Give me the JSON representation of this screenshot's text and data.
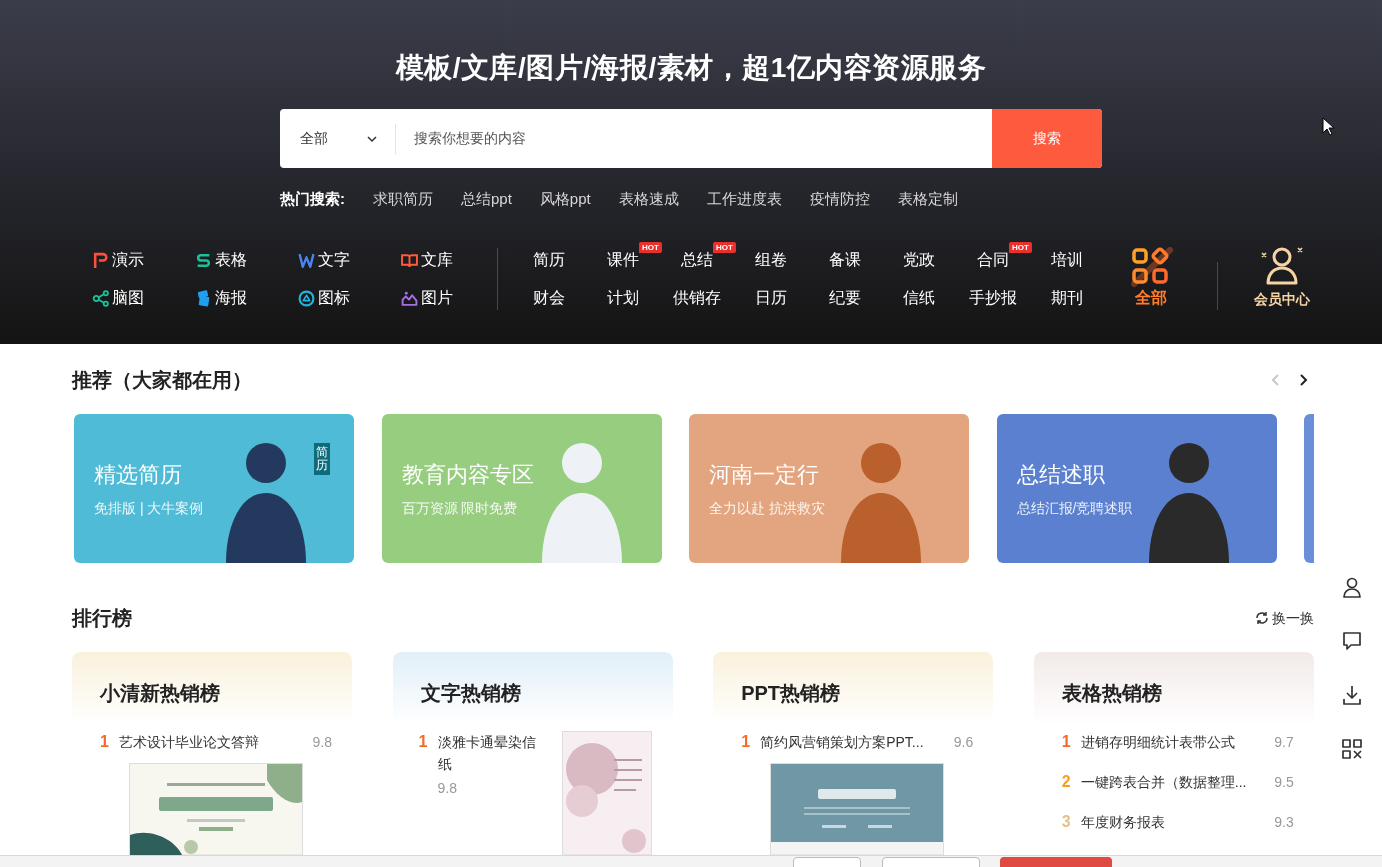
{
  "hero": {
    "title": "模板/文库/图片/海报/素材，超1亿内容资源服务",
    "search": {
      "scope": "全部",
      "placeholder": "搜索你想要的内容",
      "button": "搜索"
    },
    "hot_searches": {
      "label": "热门搜索:",
      "items": [
        "求职简历",
        "总结ppt",
        "风格ppt",
        "表格速成",
        "工作进度表",
        "疫情防控",
        "表格定制"
      ]
    }
  },
  "categories": {
    "tools": [
      {
        "kind": "slides",
        "label": "演示"
      },
      {
        "kind": "sheet",
        "label": "表格"
      },
      {
        "kind": "doc",
        "label": "文字"
      },
      {
        "kind": "library",
        "label": "文库"
      },
      {
        "kind": "mindmap",
        "label": "脑图"
      },
      {
        "kind": "poster",
        "label": "海报"
      },
      {
        "kind": "icon",
        "label": "图标"
      },
      {
        "kind": "image",
        "label": "图片"
      }
    ],
    "topics": [
      {
        "label": "简历"
      },
      {
        "label": "课件",
        "badge": "HOT"
      },
      {
        "label": "总结",
        "badge": "HOT"
      },
      {
        "label": "组卷"
      },
      {
        "label": "备课"
      },
      {
        "label": "党政"
      },
      {
        "label": "合同",
        "badge": "HOT"
      },
      {
        "label": "培训"
      },
      {
        "label": "财会"
      },
      {
        "label": "计划"
      },
      {
        "label": "供销存"
      },
      {
        "label": "日历"
      },
      {
        "label": "纪要"
      },
      {
        "label": "信纸"
      },
      {
        "label": "手抄报"
      },
      {
        "label": "期刊"
      }
    ],
    "all": {
      "label": "全部"
    },
    "member": {
      "label": "会员中心"
    }
  },
  "recommend": {
    "title": "推荐（大家都在用）",
    "prev": {
      "disabled": true
    },
    "next": {
      "disabled": false
    },
    "cards": [
      {
        "title": "精选简历",
        "subtitle": "免排版 | 大牛案例",
        "badge": "简历",
        "color": "#4fbbd6"
      },
      {
        "title": "教育内容专区",
        "subtitle": "百万资源 限时免费",
        "color": "#97cd7f"
      },
      {
        "title": "河南一定行",
        "subtitle": "全力以赴 抗洪救灾",
        "color": "#e3a57f"
      },
      {
        "title": "总结述职",
        "subtitle": "总结汇报/竞聘述职",
        "color": "#5b80cf"
      },
      {
        "color": "#6a8fd8"
      }
    ]
  },
  "ranking": {
    "title": "排行榜",
    "refresh": "换一换",
    "boards": [
      {
        "kind": "preview",
        "title": "小清新热销榜",
        "color": "#faf1dc",
        "items": [
          {
            "rank": "1",
            "title": "艺术设计毕业论文答辩",
            "score": "9.8"
          }
        ]
      },
      {
        "kind": "side",
        "title": "文字热销榜",
        "color": "#e1eff8",
        "items": [
          {
            "rank": "1",
            "title": "淡雅卡通晕染信纸",
            "score": "9.8"
          }
        ]
      },
      {
        "kind": "preview",
        "title": "PPT热销榜",
        "color": "#faf1dc",
        "items": [
          {
            "rank": "1",
            "title": "简约风营销策划方案PPT...",
            "score": "9.6"
          }
        ]
      },
      {
        "kind": "list",
        "title": "表格热销榜",
        "color": "#f2eae8",
        "items": [
          {
            "rank": "1",
            "title": "进销存明细统计表带公式",
            "score": "9.7"
          },
          {
            "rank": "2",
            "title": "一键跨表合并（数据整理...",
            "score": "9.5"
          },
          {
            "rank": "3",
            "title": "年度财务报表",
            "score": "9.3"
          }
        ]
      }
    ]
  }
}
